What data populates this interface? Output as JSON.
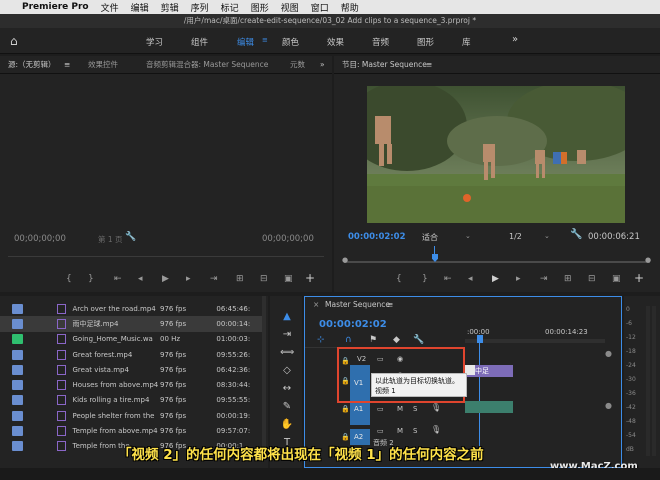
{
  "menubar": {
    "apple": "",
    "app": "Premiere Pro",
    "items": [
      "文件",
      "编辑",
      "剪辑",
      "序列",
      "标记",
      "图形",
      "视图",
      "窗口",
      "帮助"
    ]
  },
  "titlebar": {
    "path": "/用户/mac/桌面/create-edit-sequence/03_02 Add clips to a sequence_3.prproj *"
  },
  "workspaces": {
    "items": [
      "学习",
      "组件",
      "编辑",
      "颜色",
      "效果",
      "音频",
      "图形",
      "库"
    ],
    "active_index": 2,
    "more": "»"
  },
  "source_panel": {
    "tabs": [
      "源:（无剪辑）",
      "效果控件",
      "音频剪辑混合器: Master Sequence",
      "元数"
    ],
    "timecode_left": "00;00;00;00",
    "page": "第 1 页",
    "timecode_right": "00;00;00;00"
  },
  "program_panel": {
    "tab": "节目: Master Sequence",
    "timecode": "00:00:02:02",
    "fit": "适合",
    "resolution": "1/2",
    "duration": "00:00:06:21"
  },
  "project": {
    "files": [
      {
        "name": "Arch over the road.mp4",
        "fps": "976 fps",
        "dur": "06:45:46:",
        "color": "blue"
      },
      {
        "name": "雨中足球.mp4",
        "fps": "976 fps",
        "dur": "00:00:14:",
        "color": "blue",
        "selected": true
      },
      {
        "name": "Going_Home_Music.wa",
        "fps": "00 Hz",
        "dur": "01:00:03:",
        "color": "green"
      },
      {
        "name": "Great forest.mp4",
        "fps": "976 fps",
        "dur": "09:55:26:",
        "color": "blue"
      },
      {
        "name": "Great vista.mp4",
        "fps": "976 fps",
        "dur": "06:42:36:",
        "color": "blue"
      },
      {
        "name": "Houses from above.mp4",
        "fps": "976 fps",
        "dur": "08:30:44:",
        "color": "blue"
      },
      {
        "name": "Kids rolling a tire.mp4",
        "fps": "976 fps",
        "dur": "09:55:55:",
        "color": "blue"
      },
      {
        "name": "People shelter from the",
        "fps": "976 fps",
        "dur": "00:00:19:",
        "color": "blue"
      },
      {
        "name": "Temple from above.mp4",
        "fps": "976 fps",
        "dur": "09:57:07:",
        "color": "blue"
      },
      {
        "name": "Temple from the",
        "fps": "976 fps",
        "dur": "00:00:1",
        "color": "blue"
      }
    ]
  },
  "timeline": {
    "tab": "Master Sequence",
    "timecode": "00:00:02:02",
    "ruler": [
      ":00:00",
      "00:00:14:23"
    ],
    "tracks": {
      "v2": "V2",
      "v1": "V1",
      "a1": "A1",
      "a2": "A2",
      "audio2": "音频 2",
      "m": "M",
      "s": "S"
    },
    "clip_label": "雨中足",
    "tooltip_line1": "以此轨道为目标切换轨道。",
    "tooltip_line2": "视频 1"
  },
  "subtitle": "「视频 2」的任何内容都将出现在「视频 1」的任何内容之前",
  "watermark": "www.MacZ.com",
  "vu_labels": [
    "0",
    "-6",
    "-12",
    "-18",
    "-24",
    "-30",
    "-36",
    "-42",
    "-48",
    "-54",
    "dB"
  ],
  "colors": {
    "accent": "#3d8de8",
    "highlight_box": "#e0452e",
    "subtitle": "#ffe24a"
  }
}
